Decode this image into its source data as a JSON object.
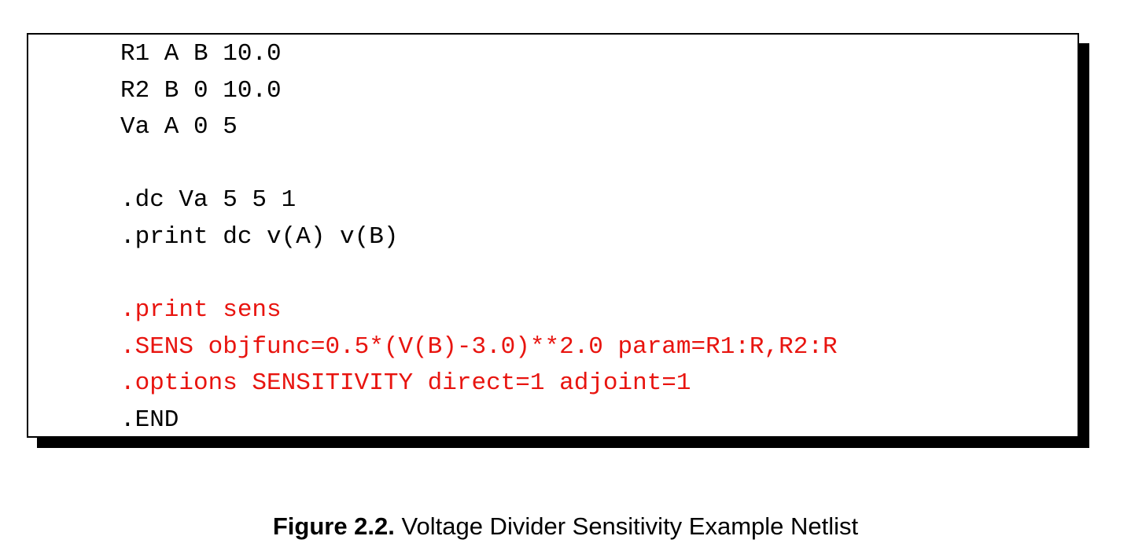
{
  "netlist": {
    "lines": [
      {
        "text": "R1 A B 10.0",
        "highlight": false
      },
      {
        "text": "R2 B 0 10.0",
        "highlight": false
      },
      {
        "text": "Va A 0 5",
        "highlight": false
      },
      {
        "text": "",
        "highlight": false
      },
      {
        "text": ".dc Va 5 5 1",
        "highlight": false
      },
      {
        "text": ".print dc v(A) v(B)",
        "highlight": false
      },
      {
        "text": "",
        "highlight": false
      },
      {
        "text": ".print sens",
        "highlight": true
      },
      {
        "text": ".SENS objfunc=0.5*(V(B)-3.0)**2.0 param=R1:R,R2:R",
        "highlight": true
      },
      {
        "text": ".options SENSITIVITY direct=1 adjoint=1",
        "highlight": true
      },
      {
        "text": ".END",
        "highlight": false
      }
    ],
    "highlight_color": "#e8140f"
  },
  "caption": {
    "label": "Figure 2.2.",
    "text": "Voltage Divider Sensitivity Example Netlist"
  }
}
